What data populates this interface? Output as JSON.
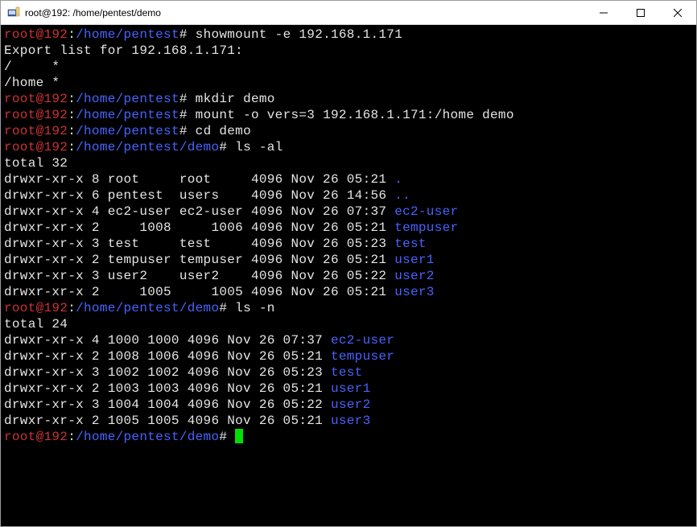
{
  "window": {
    "title": "root@192: /home/pentest/demo"
  },
  "prompts": {
    "p1_user": "root@192",
    "p1_path": "/home/pentest",
    "p2_path": "/home/pentest/demo",
    "suffix": "#",
    "colon": ":"
  },
  "cmds": {
    "showmount": " showmount -e 192.168.1.171",
    "mkdir": " mkdir demo",
    "mount": " mount -o vers=3 192.168.1.171:/home demo",
    "cd": " cd demo",
    "lsal": " ls -al",
    "lsn": " ls -n"
  },
  "out": {
    "export_header": "Export list for 192.168.1.171:",
    "export1": "/     *",
    "export2": "/home *",
    "total32": "total 32",
    "total24": "total 24"
  },
  "ls_al": [
    {
      "pre": "drwxr-xr-x 8 root     root     4096 Nov 26 05:21 ",
      "name": "."
    },
    {
      "pre": "drwxr-xr-x 6 pentest  users    4096 Nov 26 14:56 ",
      "name": ".."
    },
    {
      "pre": "drwxr-xr-x 4 ec2-user ec2-user 4096 Nov 26 07:37 ",
      "name": "ec2-user"
    },
    {
      "pre": "drwxr-xr-x 2     1008     1006 4096 Nov 26 05:21 ",
      "name": "tempuser"
    },
    {
      "pre": "drwxr-xr-x 3 test     test     4096 Nov 26 05:23 ",
      "name": "test"
    },
    {
      "pre": "drwxr-xr-x 2 tempuser tempuser 4096 Nov 26 05:21 ",
      "name": "user1"
    },
    {
      "pre": "drwxr-xr-x 3 user2    user2    4096 Nov 26 05:22 ",
      "name": "user2"
    },
    {
      "pre": "drwxr-xr-x 2     1005     1005 4096 Nov 26 05:21 ",
      "name": "user3"
    }
  ],
  "ls_n": [
    {
      "pre": "drwxr-xr-x 4 1000 1000 4096 Nov 26 07:37 ",
      "name": "ec2-user"
    },
    {
      "pre": "drwxr-xr-x 2 1008 1006 4096 Nov 26 05:21 ",
      "name": "tempuser"
    },
    {
      "pre": "drwxr-xr-x 3 1002 1002 4096 Nov 26 05:23 ",
      "name": "test"
    },
    {
      "pre": "drwxr-xr-x 2 1003 1003 4096 Nov 26 05:21 ",
      "name": "user1"
    },
    {
      "pre": "drwxr-xr-x 3 1004 1004 4096 Nov 26 05:22 ",
      "name": "user2"
    },
    {
      "pre": "drwxr-xr-x 2 1005 1005 4096 Nov 26 05:21 ",
      "name": "user3"
    }
  ]
}
